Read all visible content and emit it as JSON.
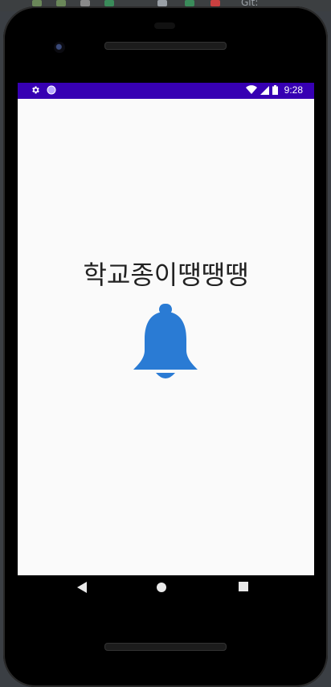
{
  "ide_toolbar": {
    "git_label": "Git:"
  },
  "status_bar": {
    "time": "9:28",
    "icons": [
      "gear-icon",
      "circle-notification-icon",
      "wifi-icon",
      "signal-icon",
      "battery-icon"
    ],
    "background": "#3700b3"
  },
  "app": {
    "title": "학교종이땡땡땡",
    "bell_color": "#2a7bd4",
    "background": "#fafafa"
  },
  "nav_bar": {
    "buttons": [
      "back-icon",
      "home-icon",
      "recents-icon"
    ]
  }
}
